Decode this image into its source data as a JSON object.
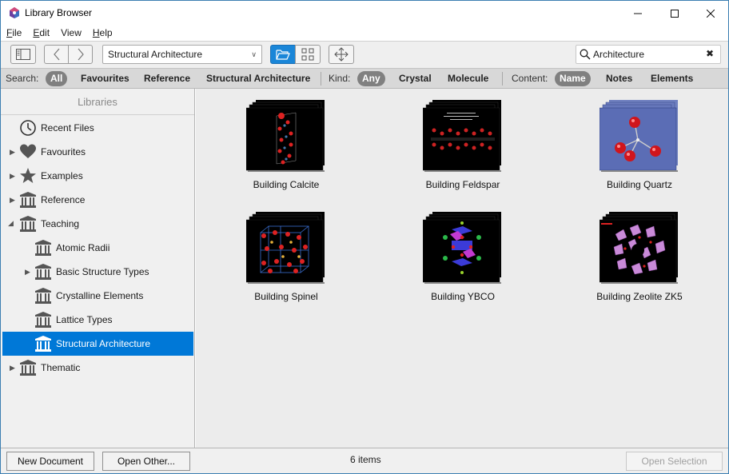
{
  "window": {
    "title": "Library Browser",
    "accent": "#0078d7"
  },
  "menu": [
    {
      "accel": "F",
      "rest": "ile"
    },
    {
      "accel": "E",
      "rest": "dit"
    },
    {
      "accel": "V",
      "rest": "iew",
      "no_accel": true
    },
    {
      "accel": "H",
      "rest": "elp"
    }
  ],
  "toolbar": {
    "library_select": "Structural Architecture",
    "search_value": "Architecture"
  },
  "filters": {
    "search_label": "Search:",
    "search_options": [
      "All",
      "Favourites",
      "Reference",
      "Structural Architecture"
    ],
    "kind_label": "Kind:",
    "kind_options": [
      "Any",
      "Crystal",
      "Molecule"
    ],
    "content_label": "Content:",
    "content_options": [
      "Name",
      "Notes",
      "Elements"
    ]
  },
  "sidebar": {
    "header": "Libraries",
    "items": [
      {
        "label": "Recent Files",
        "icon": "clock-icon",
        "level": 0,
        "arrow": ""
      },
      {
        "label": "Favourites",
        "icon": "heart-icon",
        "level": 0,
        "arrow": "collapsed"
      },
      {
        "label": "Examples",
        "icon": "star-icon",
        "level": 0,
        "arrow": "collapsed"
      },
      {
        "label": "Reference",
        "icon": "library-icon",
        "level": 0,
        "arrow": "collapsed"
      },
      {
        "label": "Teaching",
        "icon": "library-icon",
        "level": 0,
        "arrow": "expanded"
      },
      {
        "label": "Atomic Radii",
        "icon": "library-icon",
        "level": 1,
        "arrow": ""
      },
      {
        "label": "Basic Structure Types",
        "icon": "library-icon",
        "level": 1,
        "arrow": "collapsed"
      },
      {
        "label": "Crystalline Elements",
        "icon": "library-icon",
        "level": 1,
        "arrow": ""
      },
      {
        "label": "Lattice Types",
        "icon": "library-icon",
        "level": 1,
        "arrow": ""
      },
      {
        "label": "Structural Architecture",
        "icon": "library-icon",
        "level": 1,
        "arrow": "",
        "selected": true
      },
      {
        "label": "Thematic",
        "icon": "library-icon",
        "level": 0,
        "arrow": "collapsed"
      }
    ]
  },
  "documents": [
    {
      "label": "Building Calcite"
    },
    {
      "label": "Building Feldspar"
    },
    {
      "label": "Building Quartz"
    },
    {
      "label": "Building Spinel"
    },
    {
      "label": "Building YBCO"
    },
    {
      "label": "Building Zeolite ZK5"
    }
  ],
  "status": {
    "new_document": "New Document",
    "open_other": "Open Other...",
    "count": "6 items",
    "open_selection": "Open Selection"
  }
}
